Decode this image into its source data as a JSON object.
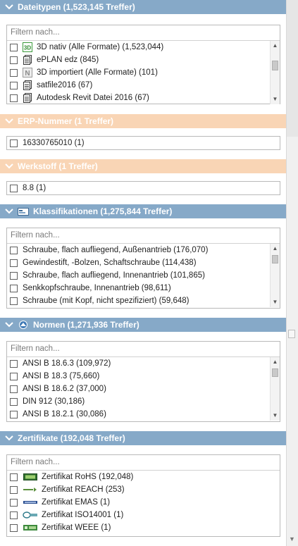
{
  "filter_placeholder": "Filtern nach...",
  "sections": {
    "dateitypen": {
      "title": "Dateitypen (1,523,145 Treffer)",
      "items": [
        {
          "icon": "3d-native-icon",
          "label": "3D nativ (Alle Formate) (1,523,044)"
        },
        {
          "icon": "document-icon",
          "label": "ePLAN edz (845)"
        },
        {
          "icon": "neutral-format-icon",
          "label": "3D importiert (Alle Formate) (101)"
        },
        {
          "icon": "document-icon",
          "label": "satfile2016 (67)"
        },
        {
          "icon": "document-icon",
          "label": "Autodesk Revit Datei 2016 (67)"
        }
      ]
    },
    "erp": {
      "title": "ERP-Nummer (1 Treffer)",
      "items": [
        {
          "label": "16330765010 (1)"
        }
      ]
    },
    "werkstoff": {
      "title": "Werkstoff (1 Treffer)",
      "items": [
        {
          "label": "8.8 (1)"
        }
      ]
    },
    "klassifikationen": {
      "title": "Klassifikationen (1,275,844 Treffer)",
      "items": [
        {
          "label": "Schraube, flach aufliegend, Außenantrieb (176,070)"
        },
        {
          "label": "Gewindestift, -Bolzen, Schaftschraube (114,438)"
        },
        {
          "label": "Schraube, flach aufliegend, Innenantrieb (101,865)"
        },
        {
          "label": "Senkkopfschraube, Innenantrieb (98,611)"
        },
        {
          "label": "Schraube (mit Kopf, nicht spezifiziert) (59,648)"
        }
      ]
    },
    "normen": {
      "title": "Normen (1,271,936 Treffer)",
      "items": [
        {
          "label": "ANSI B 18.6.3 (109,972)"
        },
        {
          "label": "ANSI B 18.3 (75,660)"
        },
        {
          "label": "ANSI B 18.6.2 (37,000)"
        },
        {
          "label": "DIN 912 (30,186)"
        },
        {
          "label": "ANSI B 18.2.1 (30,086)"
        }
      ]
    },
    "zertifikate": {
      "title": "Zertifikate (192,048 Treffer)",
      "items": [
        {
          "icon": "rohs-logo-icon",
          "label": "Zertifikat RoHS (192,048)"
        },
        {
          "icon": "reach-logo-icon",
          "label": "Zertifikat REACH (253)"
        },
        {
          "icon": "emas-logo-icon",
          "label": "Zertifikat EMAS (1)"
        },
        {
          "icon": "iso14001-logo-icon",
          "label": "Zertifikat ISO14001 (1)"
        },
        {
          "icon": "weee-logo-icon",
          "label": "Zertifikat WEEE (1)"
        }
      ]
    }
  },
  "colors": {
    "header_blue": "#86a9c8",
    "header_peach": "#f9d5b5"
  }
}
